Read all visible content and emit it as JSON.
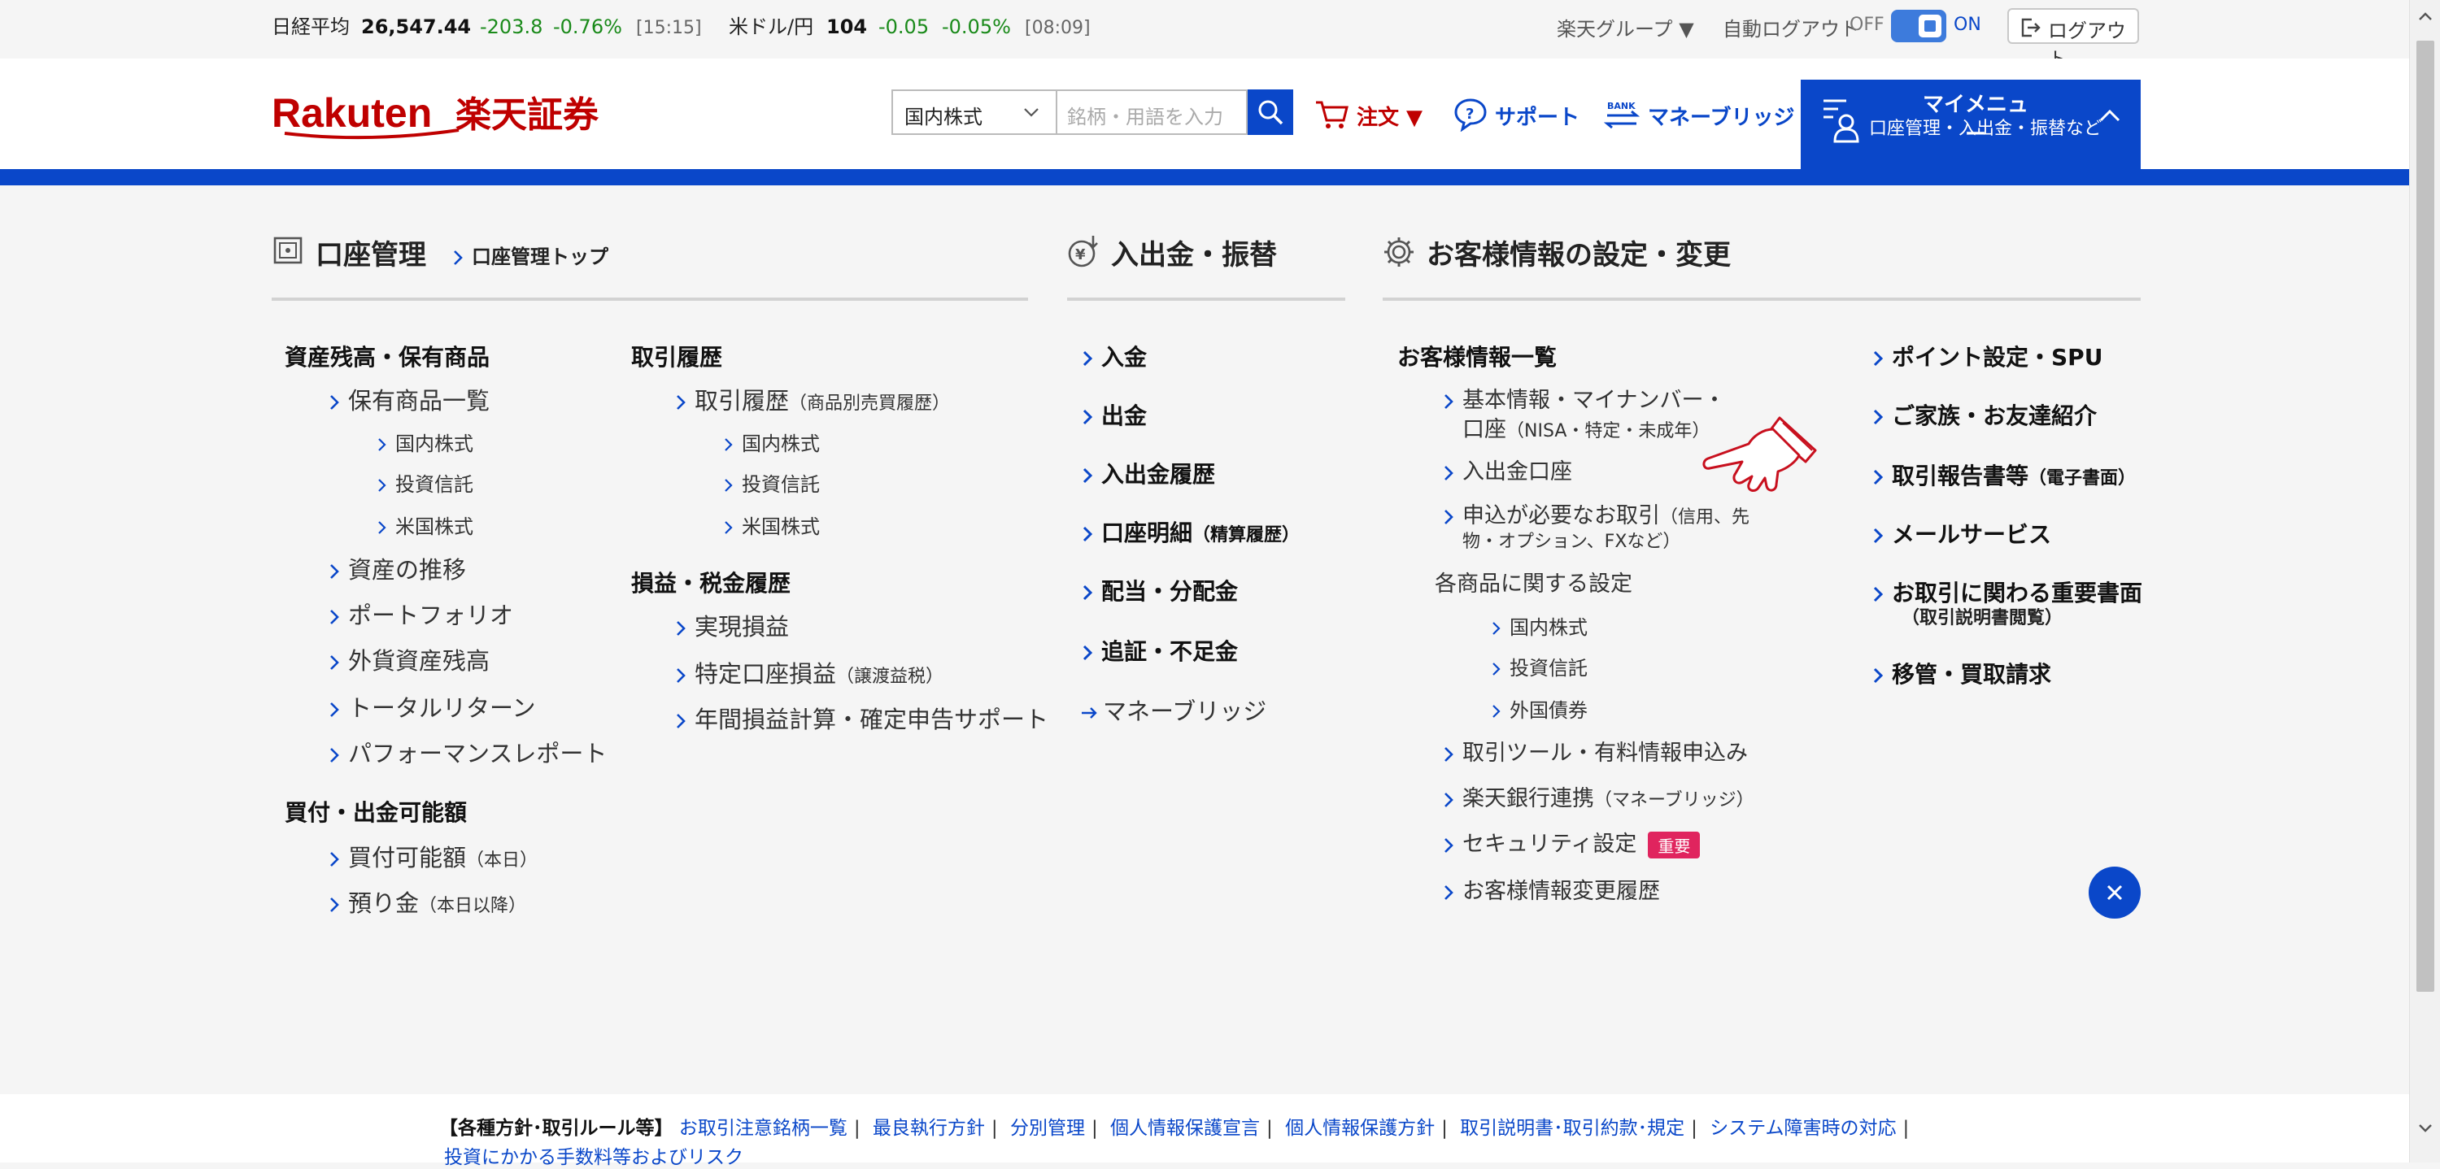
{
  "ticker": {
    "nikkei_label": "日経平均",
    "nikkei_value": "26,547.44",
    "nikkei_change": "-203.8",
    "nikkei_pct": "-0.76%",
    "nikkei_time": "[15:15]",
    "usdjpy_label": "米ドル/円",
    "usdjpy_value": "104",
    "usdjpy_change": "-0.05",
    "usdjpy_pct": "-0.05%",
    "usdjpy_time": "[08:09]",
    "group_label": "楽天グループ ▼",
    "autologout_label": "自動ログアウト",
    "autologout_off": "OFF",
    "autologout_on": "ON",
    "logout_label": "ログアウト"
  },
  "header": {
    "logo_text": "Rakuten",
    "logo_jp": "楽天証券",
    "search_select": "国内株式",
    "search_placeholder": "銘柄・用語を入力",
    "order_label": "注文 ▼",
    "support_label": "サポート",
    "bridge_label": "マネーブリッジ",
    "mymenu_title": "マイメニュー",
    "mymenu_sub": "口座管理・入出金・振替など"
  },
  "sections": {
    "account": "口座管理",
    "account_top": "口座管理トップ",
    "deposit": "入出金・振替",
    "settings": "お客様情報の設定・変更"
  },
  "col1": {
    "h1": "資産残高・保有商品",
    "holdings": "保有商品一覧",
    "dom_stock": "国内株式",
    "fund": "投資信託",
    "us_stock": "米国株式",
    "asset_trend": "資産の推移",
    "portfolio": "ポートフォリオ",
    "fx_balance": "外貨資産残高",
    "total_return": "トータルリターン",
    "perf_report": "パフォーマンスレポート",
    "h2": "買付・出金可能額",
    "buying_power": "買付可能額",
    "buying_power_note": "（本日）",
    "deposits": "預り金",
    "deposits_note": "（本日以降）"
  },
  "col2": {
    "h1": "取引履歴",
    "history": "取引履歴",
    "history_note": "（商品別売買履歴）",
    "dom_stock": "国内株式",
    "fund": "投資信託",
    "us_stock": "米国株式",
    "h2": "損益・税金履歴",
    "realized": "実現損益",
    "specific": "特定口座損益",
    "specific_note": "（譲渡益税）",
    "annual": "年間損益計算・確定申告サポート"
  },
  "col3": {
    "deposit": "入金",
    "withdraw": "出金",
    "history": "入出金履歴",
    "statement": "口座明細",
    "statement_note": "（精算履歴）",
    "dividend": "配当・分配金",
    "margin_call": "追証・不足金",
    "money_bridge": "マネーブリッジ"
  },
  "col4": {
    "h1": "お客様情報一覧",
    "basic_1": "基本情報・マイナンバー・",
    "basic_2a": "口座",
    "basic_2b": "（NISA・特定・未成年）",
    "bank_account": "入出金口座",
    "apply_1a": "申込が必要なお取引",
    "apply_1b": "（信用、先",
    "apply_2": "物・オプション、FXなど）",
    "product_settings": "各商品に関する設定",
    "dom_stock": "国内株式",
    "fund": "投資信託",
    "foreign_bond": "外国債券",
    "tools": "取引ツール・有料情報申込み",
    "bank_link": "楽天銀行連携",
    "bank_link_note": "（マネーブリッジ）",
    "security": "セキュリティ設定",
    "security_badge": "重要",
    "change_history": "お客様情報変更履歴"
  },
  "col5": {
    "points": "ポイント設定・SPU",
    "family": "ご家族・お友達紹介",
    "reports": "取引報告書等",
    "reports_note": "（電子書面）",
    "mail": "メールサービス",
    "important_1": "お取引に関わる重要書面",
    "important_2": "（取引説明書閲覧）",
    "transfer": "移管・買取請求"
  },
  "footer": {
    "lead": "【各種方針･取引ルール等】",
    "links": [
      "お取引注意銘柄一覧",
      "最良執行方針",
      "分別管理",
      "個人情報保護宣言",
      "個人情報保護方針",
      "取引説明書･取引約款･規定",
      "システム障害時の対応"
    ],
    "row2": "投資にかかる手数料等およびリスク"
  },
  "colors": {
    "brand_red": "#bf0000",
    "brand_blue": "#0a47c9",
    "up_green": "#1a8a1a",
    "badge_red": "#e0245e"
  }
}
